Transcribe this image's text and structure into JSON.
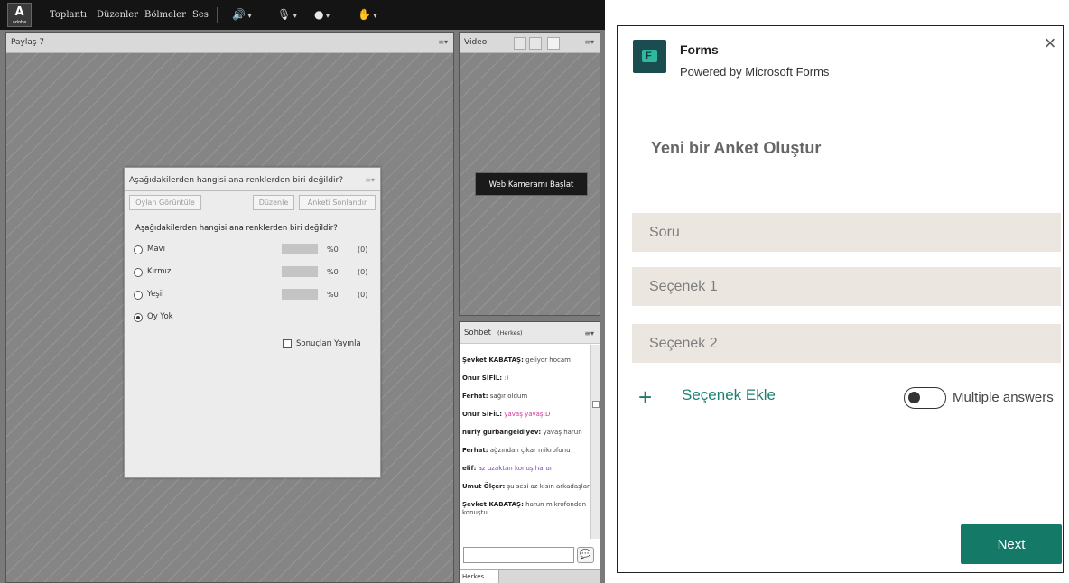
{
  "connect": {
    "menu": [
      "Toplantı",
      "Düzenler",
      "Bölmeler",
      "Ses"
    ],
    "share_pod_title": "Paylaş 7",
    "video_pod_title": "Video",
    "webcam_button": "Web Kameramı Başlat",
    "poll": {
      "title": "Aşağıdakilerden hangisi ana renklerden biri değildir?",
      "buttons": {
        "view_votes": "Oylan Görüntüle",
        "edit": "Düzenle",
        "end_poll": "Anketi Sonlandır"
      },
      "question": "Aşağıdakilerden hangisi ana renklerden biri değildir?",
      "options": [
        {
          "label": "Mavi",
          "pct": "%0",
          "count": "(0)"
        },
        {
          "label": "Kırmızı",
          "pct": "%0",
          "count": "(0)"
        },
        {
          "label": "Yeşil",
          "pct": "%0",
          "count": "(0)"
        },
        {
          "label": "Oy Yok",
          "pct": "",
          "count": ""
        }
      ],
      "publish_label": "Sonuçları Yayınla"
    },
    "chat": {
      "title": "Sohbet",
      "scope": "(Herkes)",
      "tab": "Herkes",
      "messages": [
        {
          "author": "Şevket KABATAŞ:",
          "text": " geliyor hocam",
          "color": "#444444"
        },
        {
          "author": "Onur SİFİL:",
          "text": " :)",
          "color": "#d0309a"
        },
        {
          "author": "Ferhat:",
          "text": " sağır oldum",
          "color": "#444444"
        },
        {
          "author": "Onur SİFİL:",
          "text": " yavaş yavaş:D",
          "color": "#d0309a"
        },
        {
          "author": "nurly gurbangeldiyev:",
          "text": " yavaş harun",
          "color": "#444444"
        },
        {
          "author": "Ferhat:",
          "text": " ağzından çıkar mikrofonu",
          "color": "#444444"
        },
        {
          "author": "elif:",
          "text": " az uzaktan konuş harun",
          "color": "#7b3fb5"
        },
        {
          "author": "Umut Ölçer:",
          "text": " şu sesi az kısın arkadaşlar",
          "color": "#444444"
        },
        {
          "author": "Şevket KABATAŞ:",
          "text": " harun mikrofondan",
          "color": "#444444"
        },
        {
          "author": "",
          "text": "konuştu",
          "color": "#444444"
        }
      ]
    }
  },
  "forms": {
    "app_title": "Forms",
    "powered_by": "Powered by Microsoft Forms",
    "heading": "Yeni bir Anket Oluştur",
    "question_placeholder": "Soru",
    "option1_placeholder": "Seçenek 1",
    "option2_placeholder": "Seçenek 2",
    "add_option": "Seçenek Ekle",
    "multiple_answers": "Multiple answers",
    "next_button": "Next",
    "accent_color": "#147a67"
  }
}
